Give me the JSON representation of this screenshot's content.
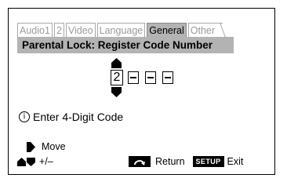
{
  "tabs": [
    {
      "label": "Audio1",
      "active": false
    },
    {
      "label": "2",
      "active": false
    },
    {
      "label": "Video",
      "active": false
    },
    {
      "label": "Language",
      "active": false
    },
    {
      "label": "General",
      "active": true
    },
    {
      "label": "Other",
      "active": false
    }
  ],
  "header": {
    "title": "Parental Lock: Register Code Number"
  },
  "code": {
    "active_digit": "2",
    "empty_slots": 3
  },
  "info": {
    "icon": "info-icon",
    "text": "Enter 4-Digit Code"
  },
  "hints": {
    "move_label": "Move",
    "adjust_label": "+/–",
    "return_label": "Return",
    "setup_key": "SETUP",
    "exit_label": "Exit"
  }
}
